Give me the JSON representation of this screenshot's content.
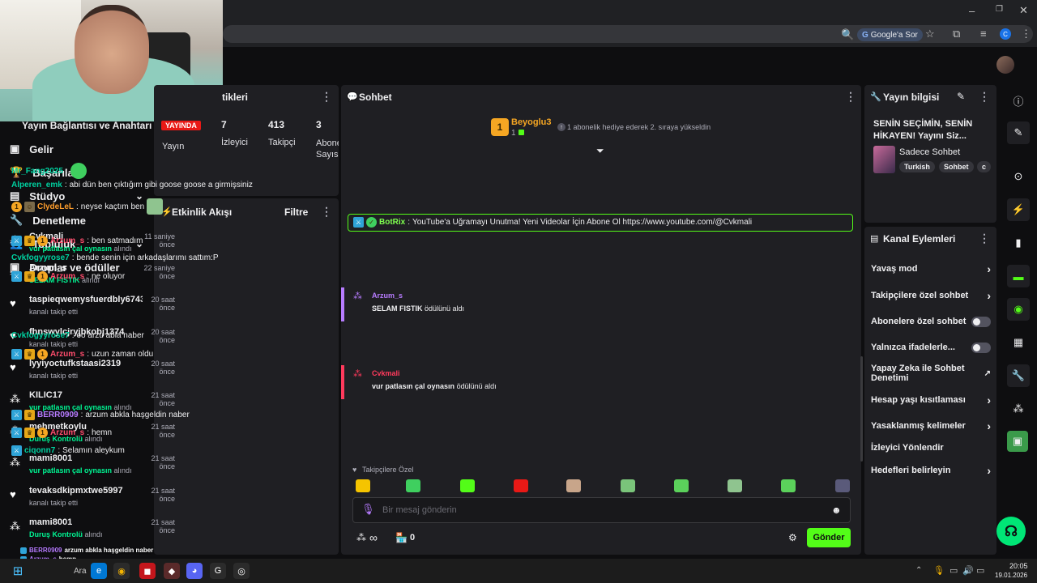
{
  "browser": {
    "search_chip": "Google'a Sor"
  },
  "sidebar": {
    "partial_item": "Yayın Bağlantısı ve Anahtarı",
    "items": [
      {
        "label": "Gelir",
        "icon": "money-icon"
      },
      {
        "label": "Başarılar",
        "icon": "trophy-icon"
      },
      {
        "label": "Stüdyo",
        "icon": "studio-icon"
      },
      {
        "label": "Denetleme",
        "icon": "wrench-icon"
      },
      {
        "label": "Topluluk",
        "icon": "community-icon"
      },
      {
        "label": "Droplar ve ödüller",
        "icon": "drops-icon"
      }
    ]
  },
  "stats": {
    "title": "tikleri",
    "live_badge": "YAYINDA",
    "cols": [
      {
        "value": "",
        "label": "Yayın"
      },
      {
        "value": "7",
        "label": "İzleyici"
      },
      {
        "value": "413",
        "label": "Takipçi"
      },
      {
        "value": "3",
        "label": "Abone Sayısı"
      }
    ]
  },
  "feed": {
    "title": "Etkinlik Akışı",
    "filter": "Filtre",
    "items": [
      {
        "name": "Cvkmali",
        "time": "11 saniye önce",
        "hl": "vur patlasın çal oynasın",
        "rest": " alındı",
        "icon": "drops-icon"
      },
      {
        "name": "Arzum_s",
        "time": "22 saniye önce",
        "hl": "SELAM FISTIK",
        "rest": " alındı",
        "icon": "drops-icon"
      },
      {
        "name": "taspieqwemysfuerdbly6743",
        "time": "20 saat önce",
        "hl": "",
        "rest": "kanalı takip etti",
        "icon": "heart-icon"
      },
      {
        "name": "fhnswylcjryjbkobj1374",
        "time": "20 saat önce",
        "hl": "",
        "rest": "kanalı takip etti",
        "icon": "heart-icon"
      },
      {
        "name": "lyyiyoctufkstaasi2319",
        "time": "20 saat önce",
        "hl": "",
        "rest": "kanalı takip etti",
        "icon": "heart-icon"
      },
      {
        "name": "KILIC17",
        "time": "21 saat önce",
        "hl": "vur patlasın çal oynasın",
        "rest": " alındı",
        "icon": "drops-icon"
      },
      {
        "name": "mehmetkoylu",
        "time": "21 saat önce",
        "hl": "Duruş Kontrolü",
        "rest": " alındı",
        "icon": "drops-icon"
      },
      {
        "name": "mami8001",
        "time": "21 saat önce",
        "hl": "vur patlasın çal oynasın",
        "rest": " alındı",
        "icon": "drops-icon"
      },
      {
        "name": "tevaksdkipmxtwe5997",
        "time": "21 saat önce",
        "hl": "",
        "rest": "kanalı takip etti",
        "icon": "heart-icon"
      },
      {
        "name": "mami8001",
        "time": "21 saat önce",
        "hl": "Duruş Kontrolü",
        "rest": " alındı",
        "icon": "drops-icon"
      }
    ]
  },
  "chat": {
    "title": "Sohbet",
    "pinned_user": "Beyoglu3",
    "pinned_count": "1",
    "pinned_text": "1 abonelik hediye ederek 2. sıraya yükseldin",
    "messages": [
      {
        "user": "Mr_Fang2025",
        "color": "#00d1a0",
        "text": ""
      },
      {
        "user": "Alperen_emk",
        "color": "#00d1a0",
        "text": "abi dün ben çıktığım gibi goose goose a girmişsiniz"
      },
      {
        "user": "ClydeLeL",
        "color": "#ff9e2c",
        "text": "neyse kaçtım ben"
      },
      {
        "user": "BotRix",
        "color": "#7fff4f",
        "text": "YouTube'a Uğramayı Unutma! Yeni Videolar İçin Abone Ol https://www.youtube.com/@Cvkmali"
      },
      {
        "user": "Arzum_s",
        "color": "#ff4d6d",
        "text": "ben satmadım"
      },
      {
        "user": "Cvkfogyyrose7",
        "color": "#00d1a0",
        "text": "bende senin için arkadaşlarımı sattım:P"
      },
      {
        "user": "Arzum_s",
        "color": "#ff4d6d",
        "text": "ne oluyor"
      },
      {
        "user": "Arzum_s",
        "color": "#b77cff",
        "text": "SELAM FISTIK",
        "suffix": "ödülünü aldı"
      },
      {
        "user": "Cvkfogyyrose7",
        "color": "#00d1a0",
        "text": "oo arzu abla naber"
      },
      {
        "user": "Arzum_s",
        "color": "#ff4d6d",
        "text": "uzun zaman oldu"
      },
      {
        "user": "Cvkmali",
        "color": "#ff3a5c",
        "text": "vur patlasın çal oynasın",
        "suffix": "ödülünü aldı"
      },
      {
        "user": "BERR0909",
        "color": "#b77cff",
        "text": "arzum abkla haşgeldin naber"
      },
      {
        "user": "Arzum_s",
        "color": "#ff4d6d",
        "text": "hemn"
      },
      {
        "user": "ciqonn7",
        "color": "#00d1a0",
        "text": "Selamın aleykum"
      }
    ],
    "followers_only": "Takipçilere Özel",
    "input_placeholder": "Bir mesaj gönderin",
    "points": "∞",
    "store_count": "0",
    "send": "Gönder"
  },
  "info": {
    "title": "Yayın bilgisi",
    "stream_title": "SENİN SEÇİMİN, SENİN HİKAYEN! Yayını Siz...",
    "category": "Sadece Sohbet",
    "tags": [
      "Turkish",
      "Sohbet",
      "c"
    ]
  },
  "actions": {
    "title": "Kanal Eylemleri",
    "items": [
      {
        "label": "Yavaş mod",
        "kind": "chevron"
      },
      {
        "label": "Takipçilere özel sohbet",
        "kind": "chevron"
      },
      {
        "label": "Abonelere özel sohbet",
        "kind": "toggle"
      },
      {
        "label": "Yalnızca ifadelerle...",
        "kind": "toggle"
      },
      {
        "label": "Yapay Zeka ile Sohbet Denetimi",
        "kind": "external"
      },
      {
        "label": "Hesap yaşı kısıtlaması",
        "kind": "chevron"
      },
      {
        "label": "Yasaklanmış kelimeler",
        "kind": "chevron"
      },
      {
        "label": "İzleyici Yönlendir",
        "kind": "none"
      },
      {
        "label": "Hedefleri belirleyin",
        "kind": "chevron"
      }
    ]
  },
  "overlay_chat": [
    {
      "user": "BERR0909",
      "text": "arzum abkla haşgeldin naber"
    },
    {
      "user": "Arzum_s",
      "text": "hemn"
    },
    {
      "user": "ciqonn7",
      "text": "Selamın aleykum"
    }
  ],
  "taskbar": {
    "search": "Ara",
    "time": "20:05",
    "date": "19.01.2026"
  },
  "colors": {
    "accent": "#53fc18",
    "panel": "#1f1f23",
    "bg": "#0e0e10"
  }
}
